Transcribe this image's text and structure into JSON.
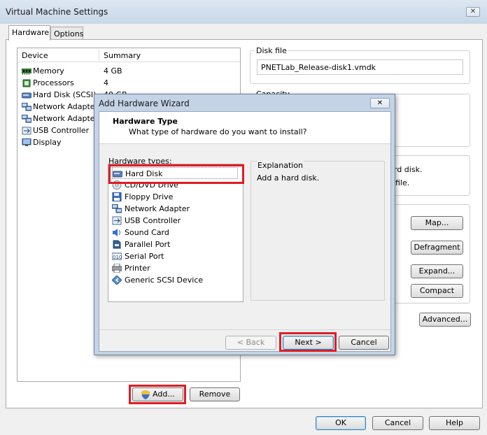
{
  "window": {
    "title": "Virtual Machine Settings",
    "close_label": "✕"
  },
  "tabs": [
    {
      "label": "Hardware"
    },
    {
      "label": "Options"
    }
  ],
  "device_list": {
    "col_device": "Device",
    "col_summary": "Summary",
    "items": [
      {
        "label": "Memory",
        "summary": "4 GB",
        "icon": "memory-icon"
      },
      {
        "label": "Processors",
        "summary": "4",
        "icon": "processor-icon"
      },
      {
        "label": "Hard Disk (SCSI)",
        "summary": "40 GB",
        "icon": "hard-disk-icon"
      },
      {
        "label": "Network Adapter",
        "summary": "",
        "icon": "network-adapter-icon"
      },
      {
        "label": "Network Adapter",
        "summary": "",
        "icon": "network-adapter-icon"
      },
      {
        "label": "USB Controller",
        "summary": "",
        "icon": "usb-icon"
      },
      {
        "label": "Display",
        "summary": "",
        "icon": "display-icon"
      }
    ]
  },
  "right_panel": {
    "disk_file_label": "Disk file",
    "disk_file_value": "PNETLab_Release-disk1.vmdk",
    "capacity_label": "Capacity",
    "partial_text_1": "rd disk.",
    "partial_text_2": "file.",
    "map_button": "Map...",
    "defragment_button": "Defragment",
    "expand_button": "Expand...",
    "compact_button": "Compact",
    "advanced_button": "Advanced..."
  },
  "hardware_buttons": {
    "add": "Add...",
    "remove": "Remove"
  },
  "footer": {
    "ok": "OK",
    "cancel": "Cancel",
    "help": "Help"
  },
  "wizard": {
    "title": "Add Hardware Wizard",
    "close_label": "✕",
    "heading": "Hardware Type",
    "subheading": "What type of hardware do you want to install?",
    "types_label": "Hardware types:",
    "types": [
      {
        "label": "Hard Disk",
        "icon": "hard-disk-icon"
      },
      {
        "label": "CD/DVD Drive",
        "icon": "cd-dvd-icon"
      },
      {
        "label": "Floppy Drive",
        "icon": "floppy-icon"
      },
      {
        "label": "Network Adapter",
        "icon": "network-adapter-icon"
      },
      {
        "label": "USB Controller",
        "icon": "usb-icon"
      },
      {
        "label": "Sound Card",
        "icon": "sound-card-icon"
      },
      {
        "label": "Parallel Port",
        "icon": "parallel-port-icon"
      },
      {
        "label": "Serial Port",
        "icon": "serial-port-icon"
      },
      {
        "label": "Printer",
        "icon": "printer-icon"
      },
      {
        "label": "Generic SCSI Device",
        "icon": "scsi-icon"
      }
    ],
    "explanation_label": "Explanation",
    "explanation_text": "Add a hard disk.",
    "back_button": "< Back",
    "next_button": "Next >",
    "cancel_button": "Cancel"
  },
  "colors": {
    "highlight": "#e01c24",
    "selection": "#cde3f7"
  }
}
